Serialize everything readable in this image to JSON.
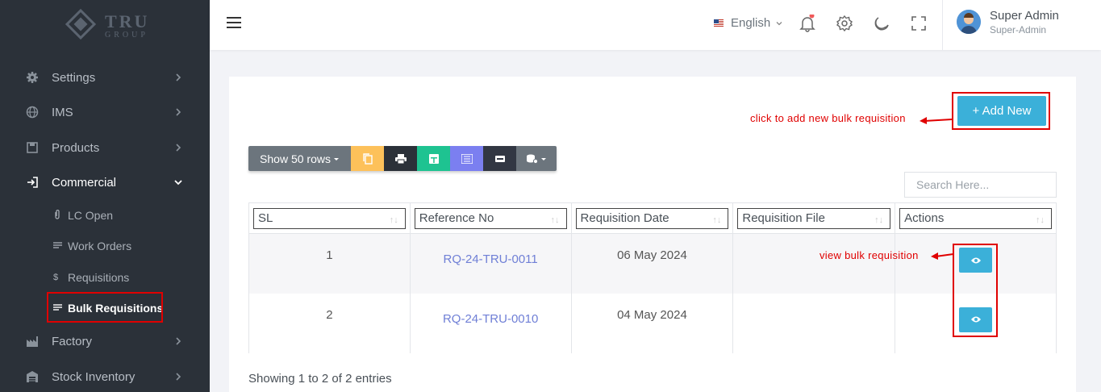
{
  "logo": {
    "text": "TRU",
    "sub": "GROUP"
  },
  "sidebar": {
    "items": [
      {
        "label": "Settings",
        "icon": "gear-icon"
      },
      {
        "label": "IMS",
        "icon": "globe-icon"
      },
      {
        "label": "Products",
        "icon": "box-icon"
      },
      {
        "label": "Commercial",
        "icon": "login-icon"
      },
      {
        "label": "Factory",
        "icon": "factory-icon"
      },
      {
        "label": "Stock Inventory",
        "icon": "warehouse-icon"
      }
    ],
    "sub_items": [
      {
        "label": "LC Open",
        "icon": "paperclip-icon",
        "glyph": "🔗"
      },
      {
        "label": "Work Orders",
        "icon": "list-icon",
        "glyph": "≡"
      },
      {
        "label": "Requisitions",
        "icon": "dollar-icon",
        "glyph": "$"
      },
      {
        "label": "Bulk Requisitions",
        "icon": "list-icon",
        "glyph": "≡"
      }
    ]
  },
  "header": {
    "language": "English",
    "user_name": "Super Admin",
    "user_role": "Super-Admin"
  },
  "main": {
    "add_button": "+ Add New",
    "annotation_add": "click to add new bulk requisition",
    "annotation_view": "view bulk requisition",
    "toolbar": {
      "show_rows": "Show 50 rows"
    },
    "search": {
      "placeholder": "Search Here..."
    },
    "table": {
      "columns": [
        "SL",
        "Reference No",
        "Requisition Date",
        "Requisition File",
        "Actions"
      ],
      "rows": [
        {
          "sl": "1",
          "ref": "RQ-24-TRU-0011",
          "date": "06 May 2024",
          "file": ""
        },
        {
          "sl": "2",
          "ref": "RQ-24-TRU-0010",
          "date": "04 May 2024",
          "file": ""
        }
      ]
    },
    "info": "Showing 1 to 2 of 2 entries"
  },
  "colors": {
    "sidebar": "#2b3139",
    "accent": "#3bb0d9",
    "annotation": "#e00000"
  }
}
